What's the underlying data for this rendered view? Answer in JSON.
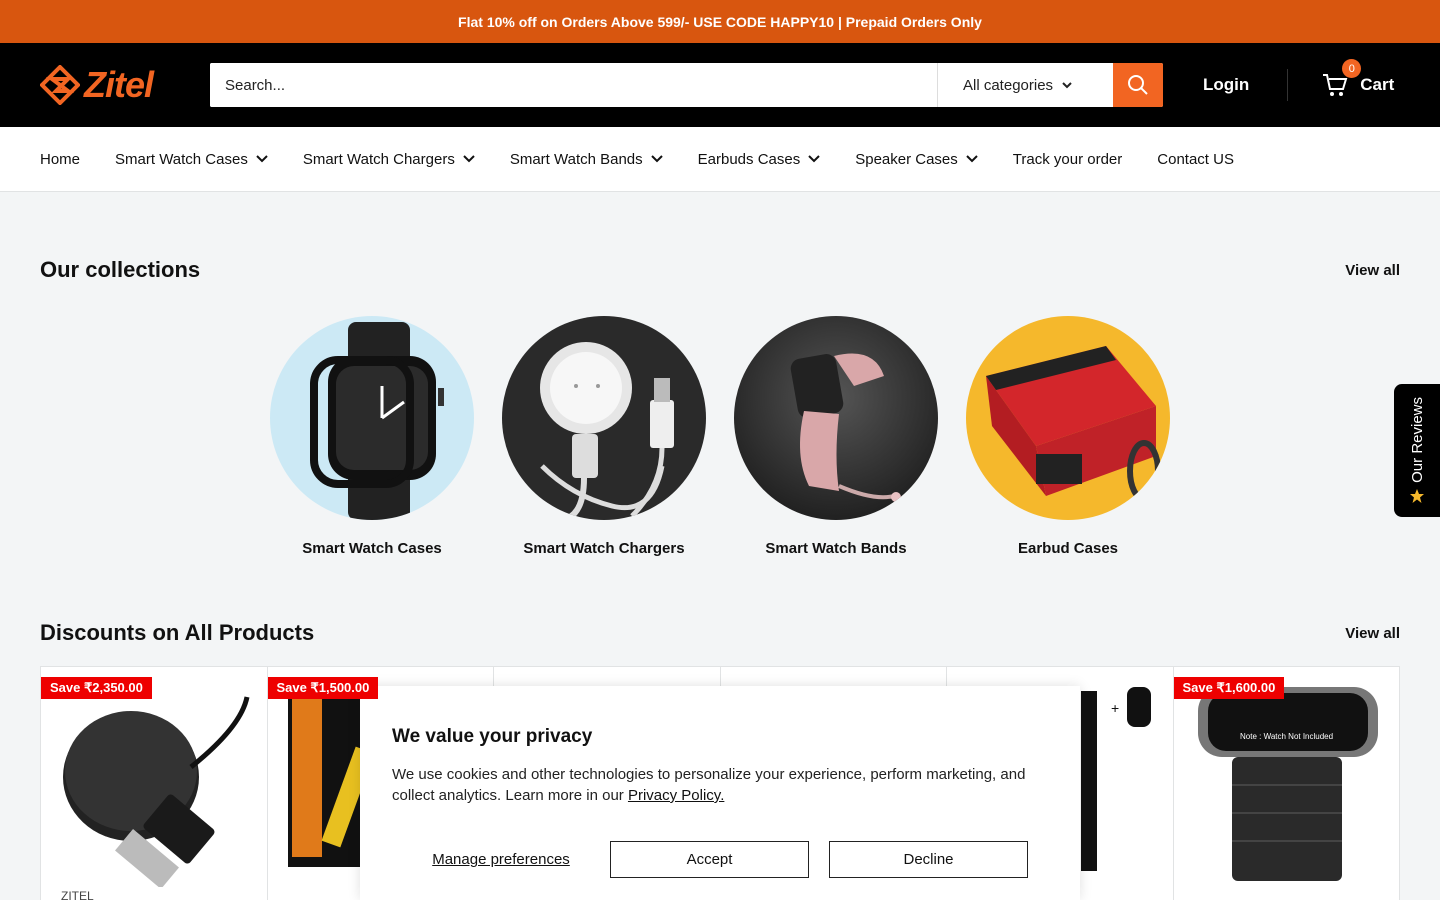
{
  "announcement": "Flat 10% off on Orders Above 599/- USE CODE HAPPY10 | Prepaid Orders Only",
  "header": {
    "logo_text": "Zitel",
    "search_placeholder": "Search...",
    "category_selected": "All categories",
    "login_label": "Login",
    "cart_label": "Cart",
    "cart_count": "0"
  },
  "nav": [
    {
      "label": "Home",
      "dropdown": false
    },
    {
      "label": "Smart Watch Cases",
      "dropdown": true
    },
    {
      "label": "Smart Watch Chargers",
      "dropdown": true
    },
    {
      "label": "Smart Watch Bands",
      "dropdown": true
    },
    {
      "label": "Earbuds Cases",
      "dropdown": true
    },
    {
      "label": "Speaker Cases",
      "dropdown": true
    },
    {
      "label": "Track your order",
      "dropdown": false
    },
    {
      "label": "Contact US",
      "dropdown": false
    }
  ],
  "collections": {
    "title": "Our collections",
    "view_all": "View all",
    "items": [
      {
        "label": "Smart Watch Cases"
      },
      {
        "label": "Smart Watch Chargers"
      },
      {
        "label": "Smart Watch Bands"
      },
      {
        "label": "Earbud Cases"
      }
    ]
  },
  "discounts": {
    "title": "Discounts on All Products",
    "view_all": "View all",
    "products": [
      {
        "badge": "Save ₹2,350.00",
        "brand": "ZITEL"
      },
      {
        "badge": "Save ₹1,500.00",
        "brand": ""
      },
      {
        "badge": "",
        "brand": ""
      },
      {
        "badge": "",
        "brand": ""
      },
      {
        "badge": "",
        "brand": ""
      },
      {
        "badge": "Save ₹1,600.00",
        "brand": ""
      }
    ],
    "note_text": "Note : Watch Not Included"
  },
  "cookie": {
    "title": "We value your privacy",
    "body": "We use cookies and other technologies to personalize your experience, perform marketing, and collect analytics. Learn more in our ",
    "link": "Privacy Policy.",
    "manage": "Manage preferences",
    "accept": "Accept",
    "decline": "Decline"
  },
  "reviews_tab": "Our Reviews",
  "colors": {
    "accent": "#d8560f",
    "brand_orange": "#f26522",
    "badge_red": "#e00000"
  }
}
